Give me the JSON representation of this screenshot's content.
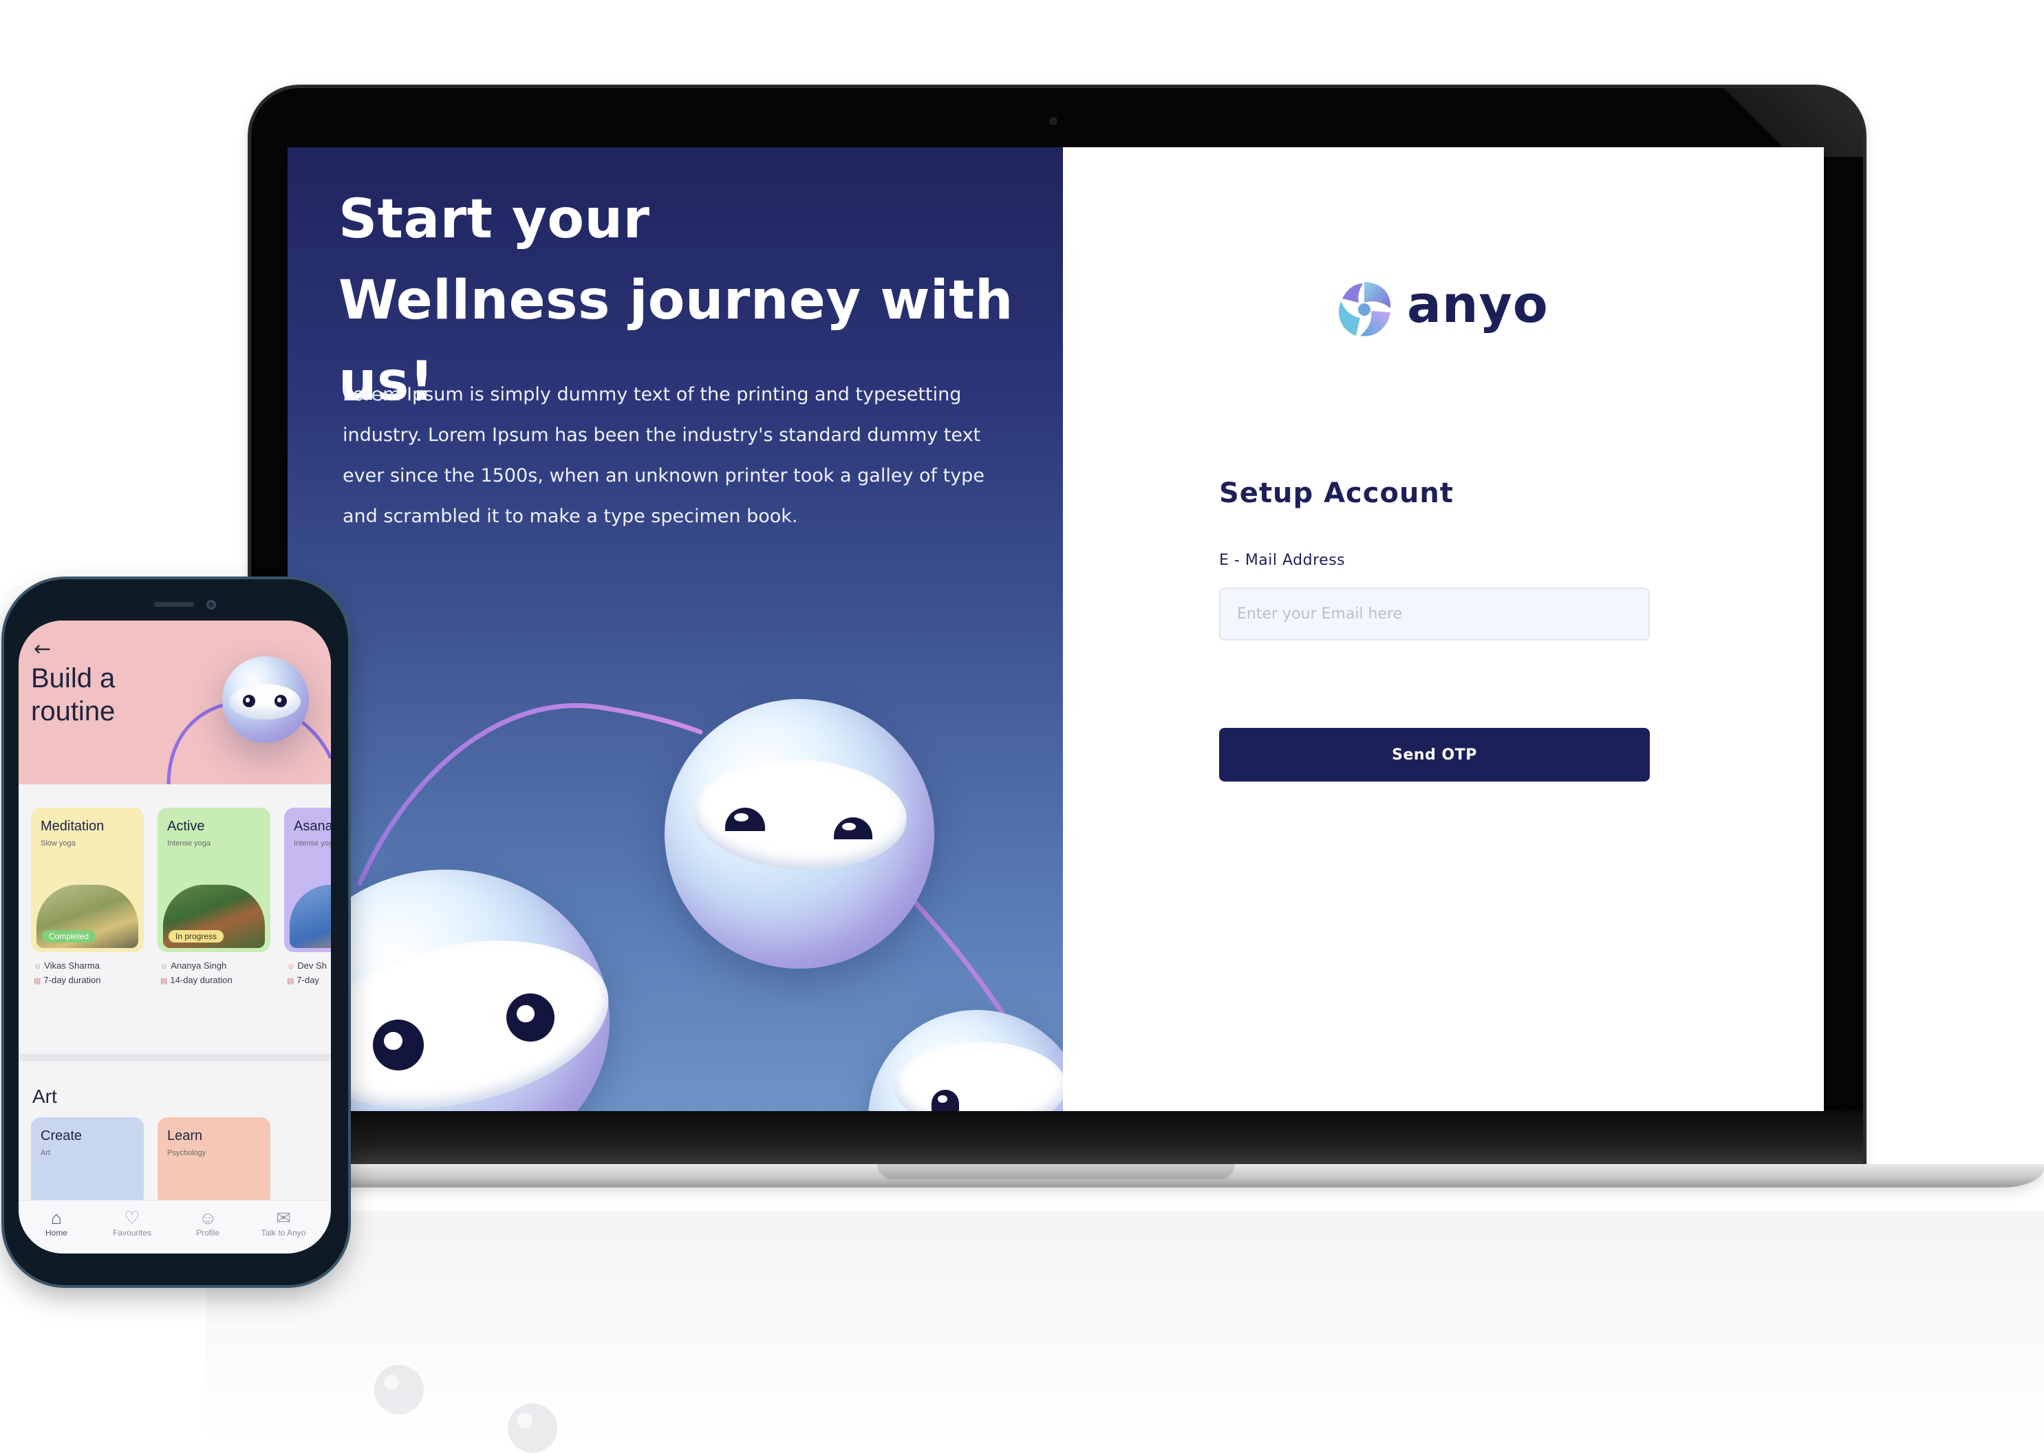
{
  "laptop": {
    "hero": {
      "title_line1": "Start your",
      "title_line2": "Wellness journey with us!",
      "body": "Lorem Ipsum is simply dummy text of the printing and typesetting industry. Lorem Ipsum has been the industry's standard dummy text ever since the 1500s, when an unknown printer took a galley of type and scrambled it to make a type specimen book."
    },
    "brand": {
      "name": "anyo",
      "logo_icon": "anyo-logo-icon"
    },
    "form": {
      "title": "Setup Account",
      "email_label": "E - Mail Address",
      "email_placeholder": "Enter your Email here",
      "email_value": "",
      "submit_label": "Send OTP"
    }
  },
  "phone": {
    "back_icon": "back-arrow-icon",
    "page_title": "Build a routine",
    "routines": [
      {
        "title": "Meditation",
        "subtitle": "Slow yoga",
        "badge": "Completed",
        "author": "Vikas Sharma",
        "duration": "7-day duration"
      },
      {
        "title": "Active",
        "subtitle": "Intense yoga",
        "badge": "In progress",
        "author": "Ananya Singh",
        "duration": "14-day duration"
      },
      {
        "title": "Asana",
        "subtitle": "Intense yoga",
        "badge": "",
        "author": "Dev Sh",
        "duration": "7-day"
      }
    ],
    "art": {
      "title": "Art",
      "cards": [
        {
          "title": "Create",
          "subtitle": "Art"
        },
        {
          "title": "Learn",
          "subtitle": "Psychology"
        }
      ]
    },
    "tabs": [
      {
        "label": "Home",
        "icon": "home-icon"
      },
      {
        "label": "Favourites",
        "icon": "heart-icon"
      },
      {
        "label": "Profile",
        "icon": "profile-icon"
      },
      {
        "label": "Talk to Anyo",
        "icon": "chat-icon"
      }
    ]
  },
  "colors": {
    "brand_navy": "#1c2058",
    "panel_gradient_top": "#1f245e",
    "panel_gradient_bottom": "#6e93c6",
    "phone_header_pink": "#f1c1c3"
  }
}
